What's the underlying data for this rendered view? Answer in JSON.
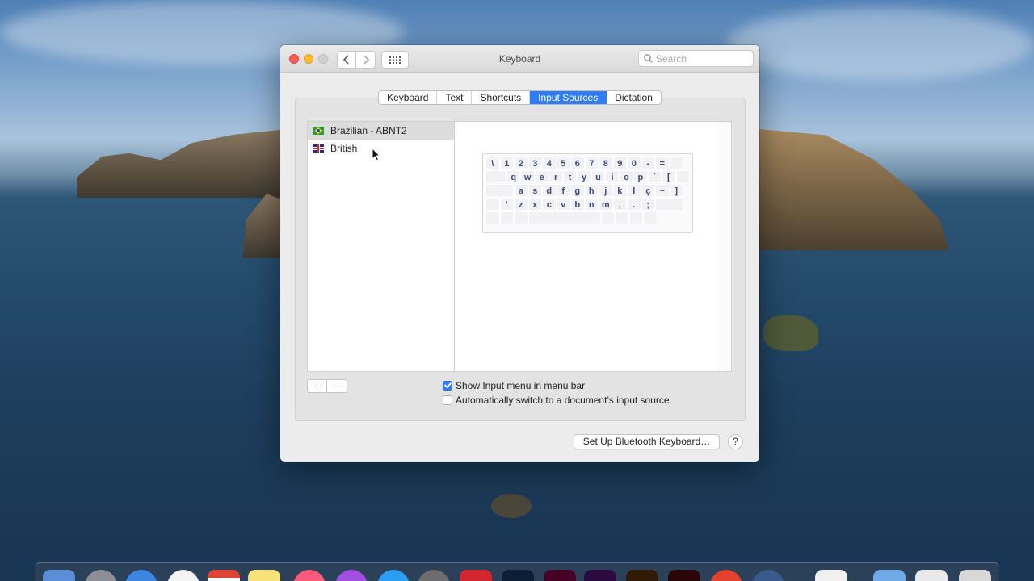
{
  "window": {
    "title": "Keyboard",
    "search_placeholder": "Search"
  },
  "tabs": [
    "Keyboard",
    "Text",
    "Shortcuts",
    "Input Sources",
    "Dictation"
  ],
  "active_tab": "Input Sources",
  "input_sources": [
    {
      "label": "Brazilian - ABNT2",
      "flag": "brazil-flag-icon",
      "selected": true
    },
    {
      "label": "British",
      "flag": "uk-flag-icon",
      "selected": false
    }
  ],
  "keyboard_rows": [
    [
      "\\",
      "1",
      "2",
      "3",
      "4",
      "5",
      "6",
      "7",
      "8",
      "9",
      "0",
      "-",
      "="
    ],
    [
      "q",
      "w",
      "e",
      "r",
      "t",
      "y",
      "u",
      "i",
      "o",
      "p",
      "´",
      "["
    ],
    [
      "a",
      "s",
      "d",
      "f",
      "g",
      "h",
      "j",
      "k",
      "l",
      "ç",
      "~",
      "]"
    ],
    [
      "'",
      "z",
      "x",
      "c",
      "v",
      "b",
      "n",
      "m",
      ",",
      ".",
      ";"
    ]
  ],
  "list_controls": {
    "add": "+",
    "remove": "−"
  },
  "options": {
    "show_input_menu": {
      "label": "Show Input menu in menu bar",
      "checked": true
    },
    "auto_switch": {
      "label": "Automatically switch to a document’s input source",
      "checked": false
    }
  },
  "buttons": {
    "bluetooth": "Set Up Bluetooth Keyboard…",
    "help": "?"
  },
  "colors": {
    "accent": "#2e7cf6"
  }
}
